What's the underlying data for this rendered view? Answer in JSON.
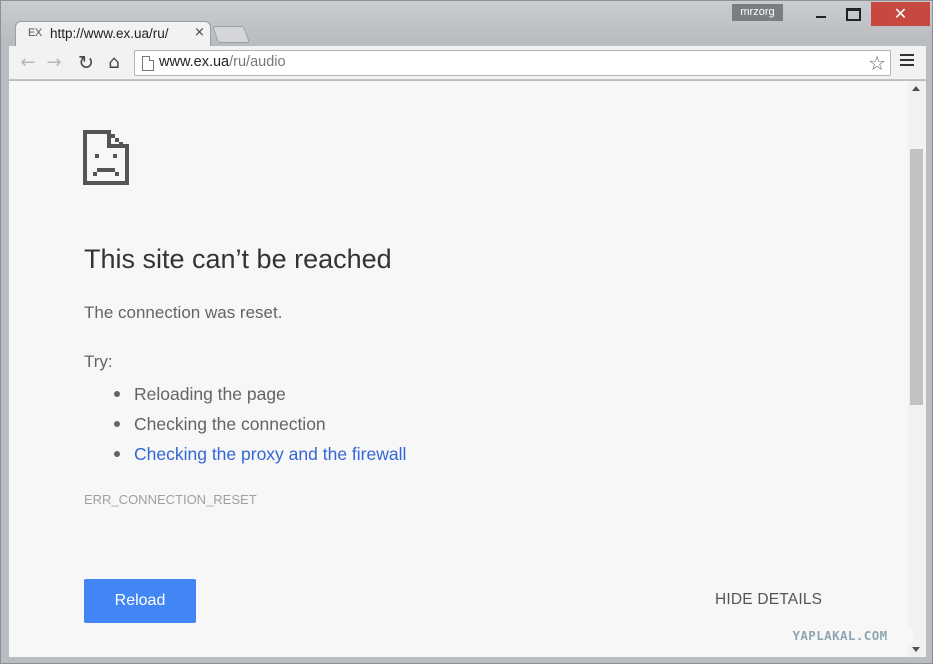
{
  "window": {
    "user_name": "mrzorg",
    "close_glyph": "✕"
  },
  "tab": {
    "favicon_text": "EX",
    "title": "http://www.ex.ua/ru/",
    "close_glyph": "×"
  },
  "toolbar": {
    "back_glyph": "←",
    "forward_glyph": "→",
    "reload_glyph": "↻",
    "home_glyph": "⌂",
    "url_host": "www.ex.ua",
    "url_path": "/ru/audio",
    "star_glyph": "☆"
  },
  "error_page": {
    "icon": "sad-document-icon",
    "headline": "This site can’t be reached",
    "message": "The connection was reset.",
    "try_label": "Try:",
    "suggestions": [
      "Reloading the page",
      "Checking the connection",
      "Checking the proxy and the firewall"
    ],
    "error_code": "ERR_CONNECTION_RESET",
    "reload_button": "Reload",
    "details_button": "HIDE DETAILS"
  },
  "watermark": "YAPLAKAL.COM",
  "colors": {
    "primary_button": "#4285f4",
    "link": "#3367d6",
    "close_button": "#c7483f"
  }
}
